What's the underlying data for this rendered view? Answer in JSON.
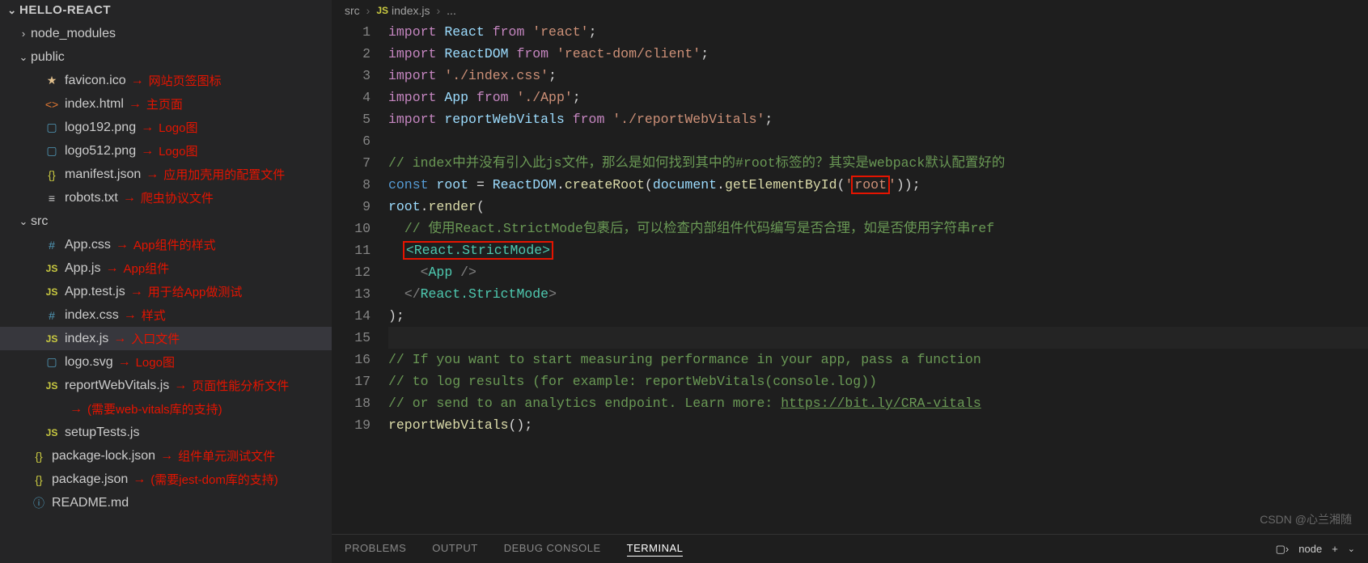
{
  "project": "HELLO-REACT",
  "tree": [
    {
      "type": "folder",
      "name": "node_modules",
      "open": false,
      "indent": 1
    },
    {
      "type": "folder",
      "name": "public",
      "open": true,
      "indent": 1
    },
    {
      "type": "file",
      "name": "favicon.ico",
      "icon": "star",
      "indent": 2,
      "note": "网站页签图标"
    },
    {
      "type": "file",
      "name": "index.html",
      "icon": "html",
      "indent": 2,
      "note": "主页面"
    },
    {
      "type": "file",
      "name": "logo192.png",
      "icon": "img",
      "indent": 2,
      "note": "Logo图"
    },
    {
      "type": "file",
      "name": "logo512.png",
      "icon": "img",
      "indent": 2,
      "note": "Logo图"
    },
    {
      "type": "file",
      "name": "manifest.json",
      "icon": "json",
      "indent": 2,
      "note": "应用加壳用的配置文件"
    },
    {
      "type": "file",
      "name": "robots.txt",
      "icon": "txt",
      "indent": 2,
      "note": "爬虫协议文件"
    },
    {
      "type": "folder",
      "name": "src",
      "open": true,
      "indent": 1
    },
    {
      "type": "file",
      "name": "App.css",
      "icon": "css",
      "indent": 2,
      "note": "App组件的样式"
    },
    {
      "type": "file",
      "name": "App.js",
      "icon": "js",
      "indent": 2,
      "note": "App组件"
    },
    {
      "type": "file",
      "name": "App.test.js",
      "icon": "js",
      "indent": 2,
      "note": "用于给App做测试"
    },
    {
      "type": "file",
      "name": "index.css",
      "icon": "css",
      "indent": 2,
      "note": "样式"
    },
    {
      "type": "file",
      "name": "index.js",
      "icon": "js",
      "indent": 2,
      "note": "入口文件",
      "active": true
    },
    {
      "type": "file",
      "name": "logo.svg",
      "icon": "img",
      "indent": 2,
      "note": "Logo图"
    },
    {
      "type": "file",
      "name": "reportWebVitals.js",
      "icon": "js",
      "indent": 2,
      "note": "页面性能分析文件"
    },
    {
      "type": "note",
      "indent": 2,
      "note": "(需要web-vitals库的支持)"
    },
    {
      "type": "file",
      "name": "setupTests.js",
      "icon": "js",
      "indent": 2,
      "note": ""
    },
    {
      "type": "file",
      "name": "package-lock.json",
      "icon": "json",
      "indent": 1,
      "note": "组件单元测试文件"
    },
    {
      "type": "file",
      "name": "package.json",
      "icon": "json",
      "indent": 1,
      "note": "(需要jest-dom库的支持)"
    },
    {
      "type": "file",
      "name": "README.md",
      "icon": "info",
      "indent": 1
    }
  ],
  "breadcrumb": {
    "folder": "src",
    "icon": "JS",
    "file": "index.js",
    "suffix": "..."
  },
  "code_lines": [
    [
      {
        "t": "import ",
        "c": "k-purple"
      },
      {
        "t": "React ",
        "c": "k-var"
      },
      {
        "t": "from ",
        "c": "k-purple"
      },
      {
        "t": "'react'",
        "c": "k-str"
      },
      {
        "t": ";",
        "c": "k-pun"
      }
    ],
    [
      {
        "t": "import ",
        "c": "k-purple"
      },
      {
        "t": "ReactDOM ",
        "c": "k-var"
      },
      {
        "t": "from ",
        "c": "k-purple"
      },
      {
        "t": "'react-dom/client'",
        "c": "k-str"
      },
      {
        "t": ";",
        "c": "k-pun"
      }
    ],
    [
      {
        "t": "import ",
        "c": "k-purple"
      },
      {
        "t": "'./index.css'",
        "c": "k-str"
      },
      {
        "t": ";",
        "c": "k-pun"
      }
    ],
    [
      {
        "t": "import ",
        "c": "k-purple"
      },
      {
        "t": "App ",
        "c": "k-var"
      },
      {
        "t": "from ",
        "c": "k-purple"
      },
      {
        "t": "'./App'",
        "c": "k-str"
      },
      {
        "t": ";",
        "c": "k-pun"
      }
    ],
    [
      {
        "t": "import ",
        "c": "k-purple"
      },
      {
        "t": "reportWebVitals ",
        "c": "k-var"
      },
      {
        "t": "from ",
        "c": "k-purple"
      },
      {
        "t": "'./reportWebVitals'",
        "c": "k-str"
      },
      {
        "t": ";",
        "c": "k-pun"
      }
    ],
    [],
    [
      {
        "t": "// index中并没有引入此js文件，那么是如何找到其中的#root标签的？其实是webpack默认配置好的",
        "c": "k-cmt"
      }
    ],
    [
      {
        "t": "const ",
        "c": "k-blue"
      },
      {
        "t": "root ",
        "c": "k-var"
      },
      {
        "t": "= ",
        "c": "k-pun"
      },
      {
        "t": "ReactDOM",
        "c": "k-var"
      },
      {
        "t": ".",
        "c": "k-pun"
      },
      {
        "t": "createRoot",
        "c": "k-fn"
      },
      {
        "t": "(",
        "c": "k-pun"
      },
      {
        "t": "document",
        "c": "k-var"
      },
      {
        "t": ".",
        "c": "k-pun"
      },
      {
        "t": "getElementById",
        "c": "k-fn"
      },
      {
        "t": "(",
        "c": "k-pun"
      },
      {
        "t": "'",
        "c": "k-str"
      },
      {
        "t": "root",
        "c": "k-str",
        "hl": true
      },
      {
        "t": "'",
        "c": "k-str"
      },
      {
        "t": "));",
        "c": "k-pun"
      }
    ],
    [
      {
        "t": "root",
        "c": "k-var"
      },
      {
        "t": ".",
        "c": "k-pun"
      },
      {
        "t": "render",
        "c": "k-fn"
      },
      {
        "t": "(",
        "c": "k-pun"
      }
    ],
    [
      {
        "t": "  ",
        "c": ""
      },
      {
        "t": "// 使用React.StrictMode包裹后，可以检查内部组件代码编写是否合理，如是否使用字符串ref",
        "c": "k-cmt"
      }
    ],
    [
      {
        "t": "  ",
        "c": ""
      },
      {
        "t": "<React.StrictMode>",
        "c": "k-tag",
        "hl": true
      }
    ],
    [
      {
        "t": "    ",
        "c": ""
      },
      {
        "t": "<",
        "c": "k-brkt"
      },
      {
        "t": "App ",
        "c": "k-tag"
      },
      {
        "t": "/>",
        "c": "k-brkt"
      }
    ],
    [
      {
        "t": "  ",
        "c": ""
      },
      {
        "t": "</",
        "c": "k-brkt"
      },
      {
        "t": "React.StrictMode",
        "c": "k-tag"
      },
      {
        "t": ">",
        "c": "k-brkt"
      }
    ],
    [
      {
        "t": ");",
        "c": "k-pun"
      }
    ],
    [],
    [
      {
        "t": "// If you want to start measuring performance in your app, pass a function",
        "c": "k-cmt"
      }
    ],
    [
      {
        "t": "// to log results (for example: reportWebVitals(console.log))",
        "c": "k-cmt"
      }
    ],
    [
      {
        "t": "// or send to an analytics endpoint. Learn more: ",
        "c": "k-cmt"
      },
      {
        "t": "https://bit.ly/CRA-vitals",
        "c": "k-cmt link"
      }
    ],
    [
      {
        "t": "reportWebVitals",
        "c": "k-fn"
      },
      {
        "t": "();",
        "c": "k-pun"
      }
    ]
  ],
  "cursor_line": 15,
  "panel": {
    "tabs": [
      "PROBLEMS",
      "OUTPUT",
      "DEBUG CONSOLE",
      "TERMINAL"
    ],
    "active": 3,
    "shell": "node"
  },
  "watermark": "CSDN @心兰湘随"
}
